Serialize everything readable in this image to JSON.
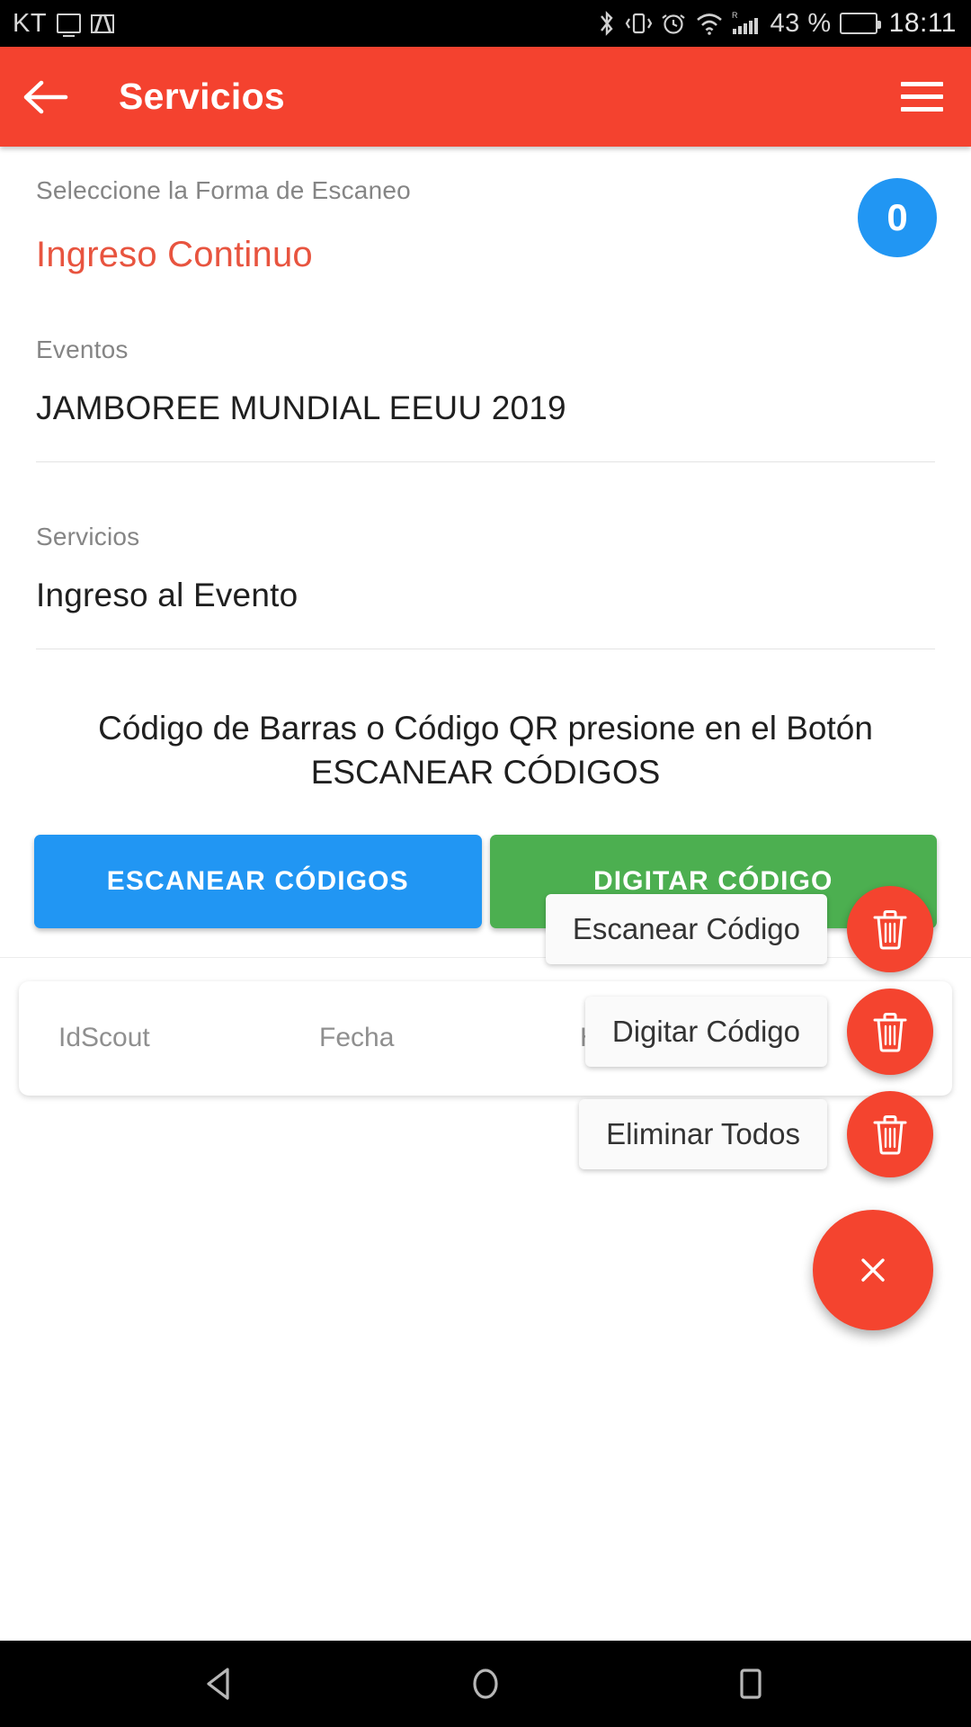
{
  "status_bar": {
    "carrier": "KT",
    "monitor_icon": "monitor-icon",
    "gmail_icon": "gmail-icon",
    "bluetooth_icon": "bluetooth-icon",
    "vibrate_icon": "vibrate-icon",
    "alarm_icon": "alarm-icon",
    "wifi_icon": "wifi-icon",
    "signal_icon": "signal-icon",
    "roaming_label": "R",
    "battery_percent": "43 %",
    "battery_level": 43,
    "time": "18:11"
  },
  "app_bar": {
    "back_icon": "back-arrow-icon",
    "title": "Servicios",
    "menu_icon": "hamburger-menu-icon"
  },
  "scan_mode": {
    "label": "Seleccione la Forma de Escaneo",
    "value": "Ingreso Continuo",
    "count": "0",
    "count_color": "#2196f3",
    "value_color": "#e8543f"
  },
  "event": {
    "label": "Eventos",
    "value": "JAMBOREE MUNDIAL EEUU 2019"
  },
  "service": {
    "label": "Servicios",
    "value": "Ingreso al Evento"
  },
  "instruction": {
    "text": "Código de Barras o Código QR presione en el Botón ESCANEAR CÓDIGOS"
  },
  "actions": {
    "scan_label": "ESCANEAR CÓDIGOS",
    "scan_color": "#2196f3",
    "digit_label": "DIGITAR CÓDIGO",
    "digit_color": "#4caf50"
  },
  "results_table": {
    "columns": [
      "IdScout",
      "Fecha",
      "Hora"
    ],
    "rows": []
  },
  "fab_menu": {
    "accent_color": "#f4442f",
    "items": [
      {
        "label": "Escanear Código",
        "icon": "trash-icon"
      },
      {
        "label": "Digitar Código",
        "icon": "trash-icon"
      },
      {
        "label": "Eliminar Todos",
        "icon": "trash-icon"
      }
    ],
    "main_icon": "close-icon"
  },
  "nav_bar": {
    "back_icon": "nav-back-triangle-icon",
    "home_icon": "nav-home-circle-icon",
    "recents_icon": "nav-recents-square-icon"
  }
}
